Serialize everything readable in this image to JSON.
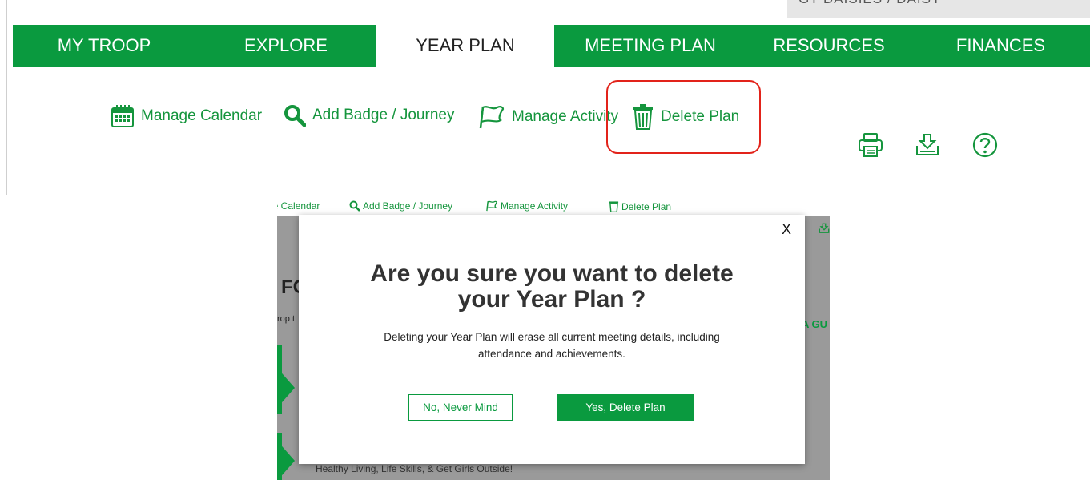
{
  "top": {
    "partial_text": "GT DAISIES / DAISY"
  },
  "nav": {
    "tabs": [
      {
        "label": "MY TROOP"
      },
      {
        "label": "EXPLORE"
      },
      {
        "label": "YEAR PLAN",
        "active": true
      },
      {
        "label": "MEETING PLAN"
      },
      {
        "label": "RESOURCES"
      },
      {
        "label": "FINANCES"
      }
    ]
  },
  "toolbar": {
    "manage_calendar": "Manage Calendar",
    "add_badge": "Add Badge / Journey",
    "manage_activity": "Manage Activity",
    "delete_plan": "Delete Plan",
    "icons": [
      "print-icon",
      "download-icon",
      "help-icon"
    ]
  },
  "inset": {
    "manage_calendar": "ge Calendar",
    "add_badge": "Add Badge / Journey",
    "manage_activity": "Manage Activity",
    "delete_plan": "Delete Plan",
    "bg_heading_fragment": "FC",
    "bg_subtext_fragment": "rop t",
    "bg_right_fragment": "A GU",
    "bg_bottom_text": "Healthy Living, Life Skills, & Get Girls Outside!"
  },
  "modal": {
    "close_label": "X",
    "title_line1": "Are you sure you want to delete",
    "title_line2": "your Year Plan ?",
    "body_line1": "Deleting your Year Plan will erase all current meeting details, including",
    "body_line2": "attendance and achievements.",
    "cancel_label": "No, Never Mind",
    "confirm_label": "Yes, Delete Plan"
  },
  "colors": {
    "brand_green": "#0a9a3f",
    "highlight_red": "#e2231a"
  }
}
